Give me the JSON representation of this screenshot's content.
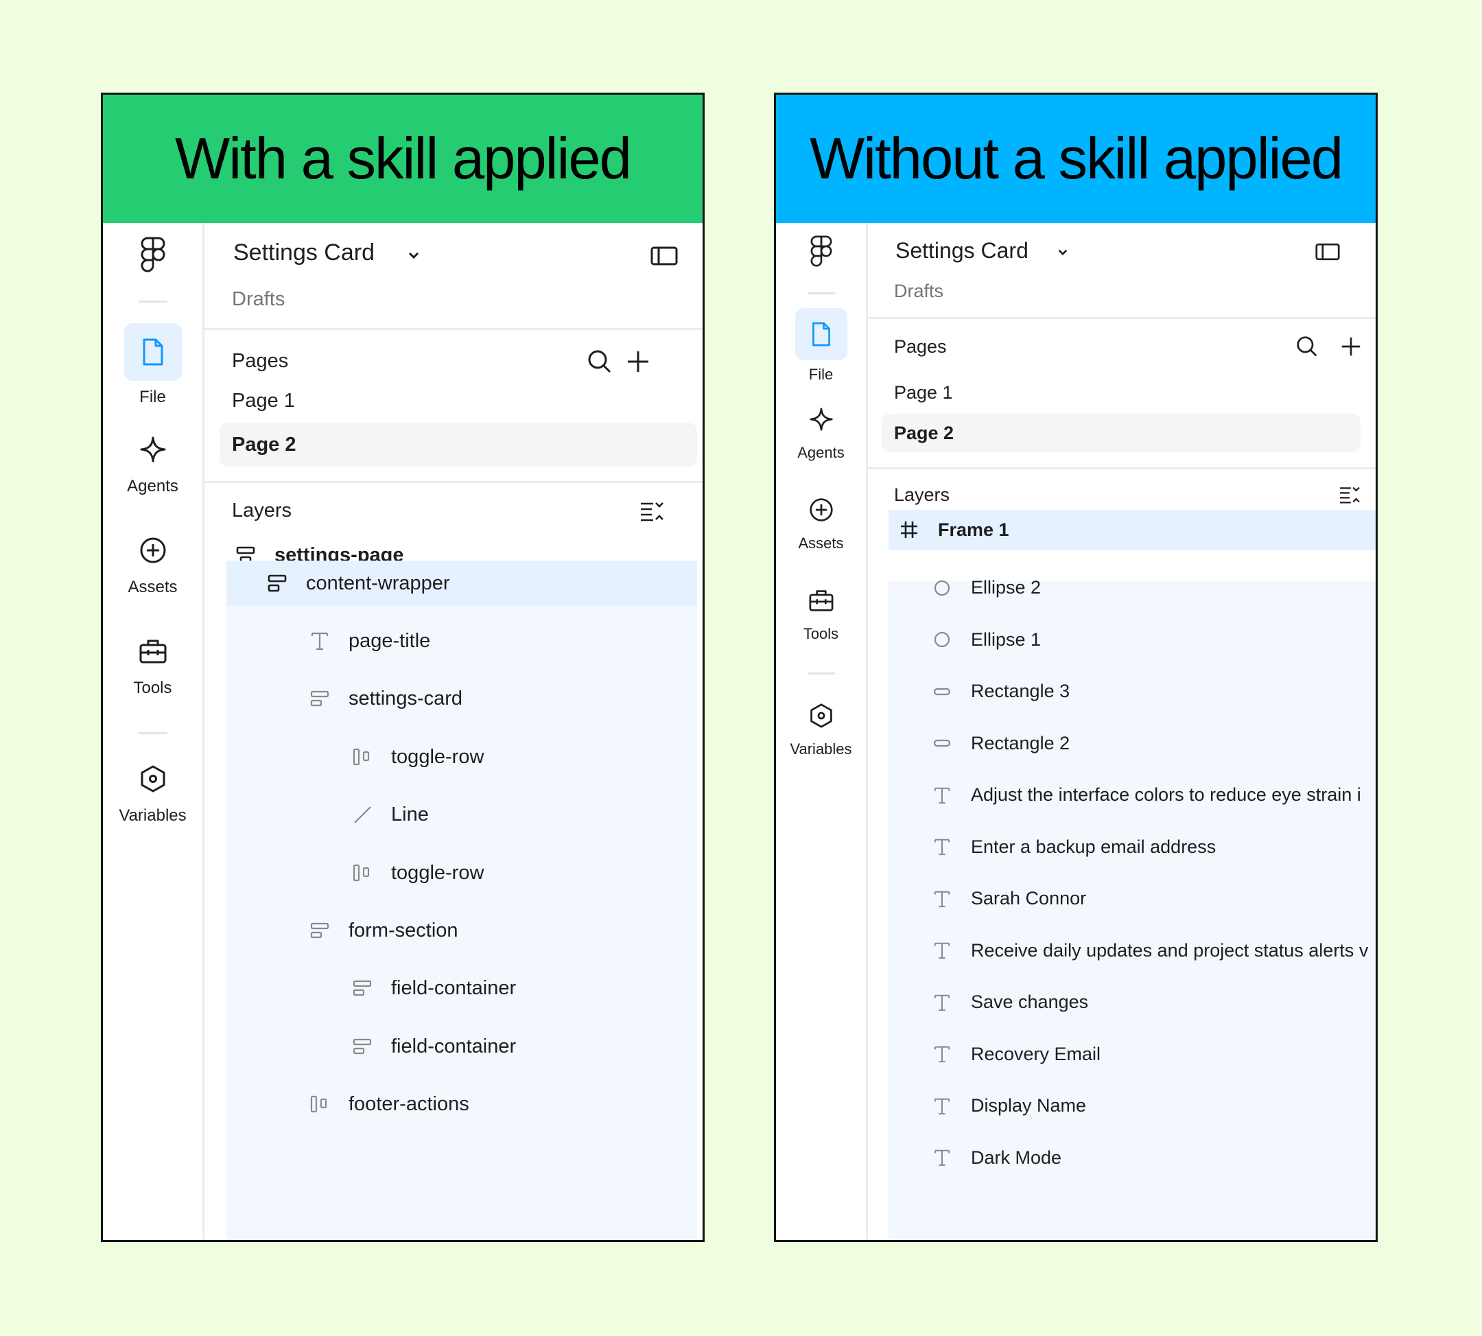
{
  "left_panel": {
    "banner": {
      "text": "With a skill applied",
      "color": "#26cc72"
    },
    "rail": {
      "items": [
        {
          "label": "File",
          "icon": "file-icon",
          "active": true
        },
        {
          "label": "Agents",
          "icon": "sparkle-icon"
        },
        {
          "label": "Assets",
          "icon": "plus-circle-icon"
        },
        {
          "label": "Tools",
          "icon": "toolbox-icon"
        },
        {
          "label": "Variables",
          "icon": "hexagon-icon"
        }
      ]
    },
    "header": {
      "file_name": "Settings Card",
      "location": "Drafts"
    },
    "pages": {
      "title": "Pages",
      "items": [
        {
          "label": "Page 1"
        },
        {
          "label": "Page 2",
          "selected": true
        }
      ]
    },
    "layers": {
      "title": "Layers",
      "items": [
        {
          "name": "settings-page",
          "icon": "autolayout-vertical-icon"
        },
        {
          "name": "content-wrapper",
          "icon": "autolayout-vertical-icon"
        },
        {
          "name": "page-title",
          "icon": "text-icon"
        },
        {
          "name": "settings-card",
          "icon": "autolayout-vertical-icon"
        },
        {
          "name": "toggle-row",
          "icon": "autolayout-horizontal-icon"
        },
        {
          "name": "Line",
          "icon": "line-icon"
        },
        {
          "name": "toggle-row",
          "icon": "autolayout-horizontal-icon"
        },
        {
          "name": "form-section",
          "icon": "autolayout-vertical-icon"
        },
        {
          "name": "field-container",
          "icon": "autolayout-vertical-icon"
        },
        {
          "name": "field-container",
          "icon": "autolayout-vertical-icon"
        },
        {
          "name": "footer-actions",
          "icon": "autolayout-horizontal-icon"
        }
      ]
    }
  },
  "right_panel": {
    "banner": {
      "text": "Without a skill applied",
      "color": "#00b4ff"
    },
    "rail": {
      "items": [
        {
          "label": "File",
          "icon": "file-icon",
          "active": true
        },
        {
          "label": "Agents",
          "icon": "sparkle-icon"
        },
        {
          "label": "Assets",
          "icon": "plus-circle-icon"
        },
        {
          "label": "Tools",
          "icon": "toolbox-icon"
        },
        {
          "label": "Variables",
          "icon": "hexagon-icon"
        }
      ]
    },
    "header": {
      "file_name": "Settings Card",
      "location": "Drafts"
    },
    "pages": {
      "title": "Pages",
      "items": [
        {
          "label": "Page 1"
        },
        {
          "label": "Page 2",
          "selected": true
        }
      ]
    },
    "layers": {
      "title": "Layers",
      "items": [
        {
          "name": "Frame 1",
          "icon": "frame-icon"
        },
        {
          "name": "Ellipse 2",
          "icon": "ellipse-icon"
        },
        {
          "name": "Ellipse 1",
          "icon": "ellipse-icon"
        },
        {
          "name": "Rectangle 3",
          "icon": "rectangle-icon"
        },
        {
          "name": "Rectangle 2",
          "icon": "rectangle-icon"
        },
        {
          "name": "Adjust the interface colors to reduce eye strain i",
          "icon": "text-icon"
        },
        {
          "name": "Enter a backup email address",
          "icon": "text-icon"
        },
        {
          "name": "Sarah Connor",
          "icon": "text-icon"
        },
        {
          "name": "Receive daily updates and project status alerts v",
          "icon": "text-icon"
        },
        {
          "name": "Save changes",
          "icon": "text-icon"
        },
        {
          "name": "Recovery Email",
          "icon": "text-icon"
        },
        {
          "name": "Display Name",
          "icon": "text-icon"
        },
        {
          "name": "Dark Mode",
          "icon": "text-icon"
        }
      ]
    }
  }
}
